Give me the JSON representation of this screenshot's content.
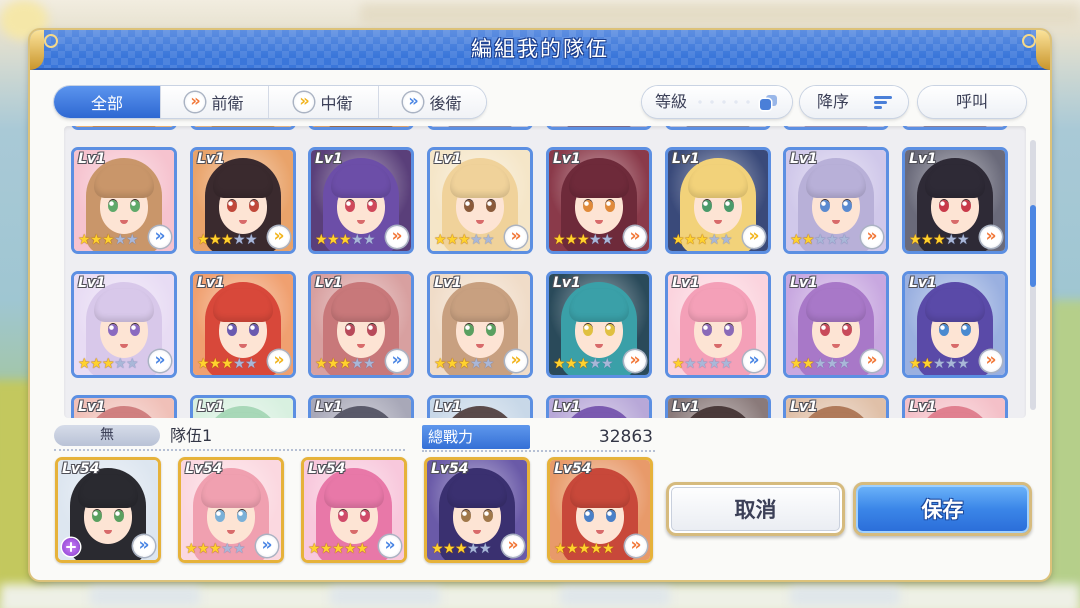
{
  "dialog": {
    "title": "編組我的隊伍"
  },
  "filters": {
    "tabs": [
      {
        "label": "全部",
        "selected": true
      },
      {
        "label": "前衛",
        "icon": "position-front-icon"
      },
      {
        "label": "中衛",
        "icon": "position-middle-icon"
      },
      {
        "label": "後衛",
        "icon": "position-back-icon"
      }
    ],
    "sort_key": {
      "label": "等級",
      "icon": "layers-icon"
    },
    "sort_order": {
      "label": "降序",
      "icon": "sort-descending-icon"
    },
    "call": {
      "label": "呼叫"
    }
  },
  "colors": {
    "accent": "#3d7ade",
    "team_frame": "#e6b23a",
    "front": "#f2793a",
    "middle": "#f2b51f",
    "back": "#4b86e4",
    "star_filled": "#ffd22e",
    "star_empty": "#a9b7d8"
  },
  "roster": {
    "rows": [
      {
        "cards": [
          {
            "hair": "#c88a50",
            "backdrop": "#eab073"
          },
          {
            "hair": "#b98a58",
            "backdrop": "#e2b282"
          },
          {
            "hair": "#9a6a48",
            "backdrop": "#d9a06c"
          },
          {
            "hair": "#8a8aa8",
            "backdrop": "#c8c8d8"
          },
          {
            "hair": "#7a6a8a",
            "backdrop": "#b8b4c8"
          },
          {
            "hair": "#8a8aa0",
            "backdrop": "#c4c4d4"
          },
          {
            "hair": "#9a90b0",
            "backdrop": "#c8c4d8"
          },
          {
            "hair": "#8a8098",
            "backdrop": "#c0bcd0"
          }
        ]
      },
      {
        "cards": [
          {
            "level": "Lv1",
            "stars": 3,
            "position_icon": "position-back-icon",
            "hair": "#c9966a",
            "eyes": "#5fa96a",
            "backdrop": "#f6c3cf"
          },
          {
            "level": "Lv1",
            "stars": 3,
            "position_icon": "position-middle-icon",
            "hair": "#3a2a2e",
            "eyes": "#c0483a",
            "backdrop": "#e9a36a"
          },
          {
            "level": "Lv1",
            "stars": 3,
            "position_icon": "position-front-icon",
            "hair": "#6c4ea8",
            "eyes": "#d0485a",
            "backdrop": "#5a3f7a"
          },
          {
            "level": "Lv1",
            "stars": 3,
            "position_icon": "position-front-icon",
            "hair": "#f0d29a",
            "eyes": "#8a5a3a",
            "backdrop": "#f5e6c8"
          },
          {
            "level": "Lv1",
            "stars": 3,
            "position_icon": "position-front-icon",
            "hair": "#6e2a3a",
            "eyes": "#e08a3a",
            "backdrop": "#8a3a4a"
          },
          {
            "level": "Lv1",
            "stars": 3,
            "position_icon": "position-middle-icon",
            "hair": "#f2d27a",
            "eyes": "#4a9a6a",
            "backdrop": "#3a4a7a"
          },
          {
            "level": "Lv1",
            "stars": 2,
            "position_icon": "position-front-icon",
            "hair": "#b8b0d8",
            "eyes": "#5a8ad0",
            "backdrop": "#d0c8ea"
          },
          {
            "level": "Lv1",
            "stars": 3,
            "position_icon": "position-front-icon",
            "hair": "#2e2a36",
            "eyes": "#c83a4a",
            "backdrop": "#6a6a7a"
          }
        ]
      },
      {
        "cards": [
          {
            "level": "Lv1",
            "stars": 3,
            "position_icon": "position-back-icon",
            "hair": "#d8c8ea",
            "eyes": "#8a6ac0",
            "backdrop": "#e8dcf4"
          },
          {
            "level": "Lv1",
            "stars": 3,
            "position_icon": "position-middle-icon",
            "hair": "#d8483a",
            "eyes": "#6a5ab0",
            "backdrop": "#f0a070"
          },
          {
            "level": "Lv1",
            "stars": 3,
            "position_icon": "position-back-icon",
            "hair": "#c8787a",
            "eyes": "#b84a5a",
            "backdrop": "#d8a0a0"
          },
          {
            "level": "Lv1",
            "stars": 3,
            "position_icon": "position-middle-icon",
            "hair": "#c8a080",
            "eyes": "#5aa060",
            "backdrop": "#f0dcc8"
          },
          {
            "level": "Lv1",
            "stars": 3,
            "position_icon": "position-front-icon",
            "hair": "#3aa0a8",
            "eyes": "#e0c040",
            "backdrop": "#2a4a5a"
          },
          {
            "level": "Lv1",
            "stars": 1,
            "position_icon": "position-back-icon",
            "hair": "#f4a0b8",
            "eyes": "#8a6ab8",
            "backdrop": "#fbd4de"
          },
          {
            "level": "Lv1",
            "stars": 2,
            "position_icon": "position-front-icon",
            "hair": "#a878c8",
            "eyes": "#c84a5a",
            "backdrop": "#c8a8e0"
          },
          {
            "level": "Lv1",
            "stars": 2,
            "position_icon": "position-front-icon",
            "hair": "#5a4aa8",
            "eyes": "#4a8ad0",
            "backdrop": "#9ab0e0"
          }
        ]
      },
      {
        "cards": [
          {
            "level": "Lv1",
            "hair": "#d08080",
            "backdrop": "#f0c0b8"
          },
          {
            "level": "Lv1",
            "hair": "#a8d8b8",
            "backdrop": "#d8f0e0"
          },
          {
            "level": "Lv1",
            "hair": "#5a5a6a",
            "backdrop": "#a8a8b8"
          },
          {
            "level": "Lv1",
            "hair": "#5a4a4a",
            "backdrop": "#c8d8e8"
          },
          {
            "level": "Lv1",
            "hair": "#7a5ab0",
            "backdrop": "#b8a8d8"
          },
          {
            "level": "Lv1",
            "hair": "#4a3a3a",
            "backdrop": "#8a7a7a"
          },
          {
            "level": "Lv1",
            "hair": "#b07a5a",
            "backdrop": "#e0c0a8"
          },
          {
            "level": "Lv1",
            "hair": "#e08090",
            "backdrop": "#f4c0c8"
          }
        ]
      }
    ]
  },
  "team": {
    "group": "無",
    "name": "隊伍1",
    "power_label": "總戰力",
    "power_value": "32863",
    "members": [
      {
        "level": "Lv54",
        "badge_icon": "plus-badge-icon",
        "position_icon": "position-back-icon",
        "hair": "#2a2a30",
        "eyes": "#5aa060",
        "backdrop": "#dde6f0"
      },
      {
        "level": "Lv54",
        "stars": 3,
        "position_icon": "position-back-icon",
        "hair": "#f0a0b0",
        "eyes": "#7ab0d8",
        "backdrop": "#fbd8e0"
      },
      {
        "level": "Lv54",
        "stars": 5,
        "position_icon": "position-back-icon",
        "hair": "#e878a8",
        "eyes": "#d04a6a",
        "backdrop": "#f8c8dc"
      },
      {
        "level": "Lv54",
        "stars": 3,
        "position_icon": "position-front-icon",
        "hair": "#3a3070",
        "eyes": "#a0784a",
        "backdrop": "#6a5aa8"
      },
      {
        "level": "Lv54",
        "stars": 5,
        "position_icon": "position-front-icon",
        "hair": "#c8483a",
        "eyes": "#4a80c8",
        "backdrop": "#e89a6a"
      }
    ]
  },
  "buttons": {
    "cancel": "取消",
    "save": "保存"
  }
}
